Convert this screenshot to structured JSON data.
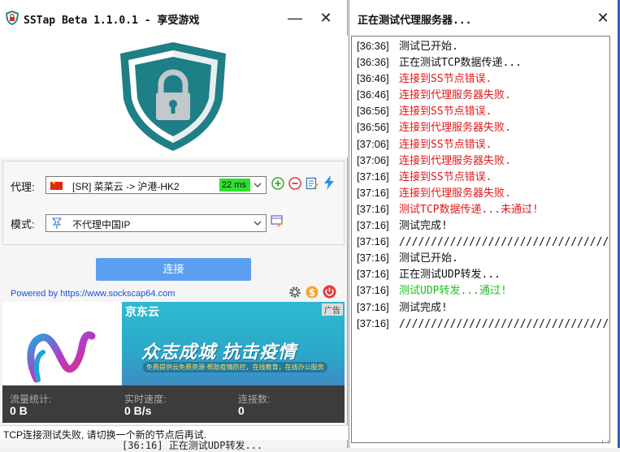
{
  "left_window": {
    "title": "SSTap Beta 1.1.0.1 - 享受游戏",
    "minimize_glyph": "—",
    "close_glyph": "✕",
    "proxy_label": "代理:",
    "proxy_value": "[SR] 菜菜云 -> 沪港-HK2",
    "proxy_ping": "22 ms",
    "mode_label": "模式:",
    "mode_value": "不代理中国IP",
    "connect_button": "连接",
    "powered_by": "Powered by https://www.sockscap64.com",
    "ad": {
      "badge": "广告",
      "brand": "京东云",
      "headline": "众志成城 抗击疫情",
      "subline": "免费提供云免费资源·帮助疫情防控，在线教育，在线办公服务"
    },
    "stats": {
      "traffic_label": "流量统计:",
      "traffic_value": "0 B",
      "speed_label": "实时速度:",
      "speed_value": "0 B/s",
      "conn_label": "连接数:",
      "conn_value": "0"
    },
    "status": "TCP连接测试失败, 请切换一个新的节点后再试.",
    "status_overflow": "[36:16] 正在测试UDP转发..."
  },
  "right_window": {
    "title": "正在测试代理服务器...",
    "close_glyph": "✕",
    "log": [
      {
        "time": "[36:36]",
        "msg": "测试已开始.",
        "kind": "normal"
      },
      {
        "time": "[36:36]",
        "msg": "正在测试TCP数据传递...",
        "kind": "normal"
      },
      {
        "time": "[36:46]",
        "msg": "连接到SS节点错误.",
        "kind": "error"
      },
      {
        "time": "[36:46]",
        "msg": "连接到代理服务器失败.",
        "kind": "error"
      },
      {
        "time": "[36:56]",
        "msg": "连接到SS节点错误.",
        "kind": "error"
      },
      {
        "time": "[36:56]",
        "msg": "连接到代理服务器失败.",
        "kind": "error"
      },
      {
        "time": "[37:06]",
        "msg": "连接到SS节点错误.",
        "kind": "error"
      },
      {
        "time": "[37:06]",
        "msg": "连接到代理服务器失败.",
        "kind": "error"
      },
      {
        "time": "[37:16]",
        "msg": "连接到SS节点错误.",
        "kind": "error"
      },
      {
        "time": "[37:16]",
        "msg": "连接到代理服务器失败.",
        "kind": "error"
      },
      {
        "time": "[37:16]",
        "msg": "测试TCP数据传递...未通过!",
        "kind": "error"
      },
      {
        "time": "[37:16]",
        "msg": "测试完成!",
        "kind": "normal"
      },
      {
        "time": "[37:16]",
        "msg": "//////////////////////////////////////////////",
        "kind": "normal"
      },
      {
        "time": "[37:16]",
        "msg": "测试已开始.",
        "kind": "normal"
      },
      {
        "time": "[37:16]",
        "msg": "正在测试UDP转发...",
        "kind": "normal"
      },
      {
        "time": "[37:16]",
        "msg": "测试UDP转发...通过!",
        "kind": "success"
      },
      {
        "time": "[37:16]",
        "msg": "测试完成!",
        "kind": "normal"
      },
      {
        "time": "[37:16]",
        "msg": "//////////////////////////////////////////////",
        "kind": "normal"
      }
    ]
  },
  "colors": {
    "connect_button": "#5b9ef2",
    "shield_teal": "#1e7f86",
    "log_error": "#e01919",
    "log_success": "#20c020",
    "stats_bg": "#3c3c3c",
    "ping_badge": "#2ee12e"
  },
  "icons": [
    "app-shield-icon",
    "lock-shield-icon",
    "cn-flag-icon",
    "add-icon",
    "remove-icon",
    "edit-icon",
    "flash-icon",
    "mode-icon",
    "mode-edit-icon",
    "gear-icon",
    "dollar-coin-icon",
    "power-icon",
    "chevron-down-icon",
    "close-icon",
    "minimize-icon"
  ]
}
